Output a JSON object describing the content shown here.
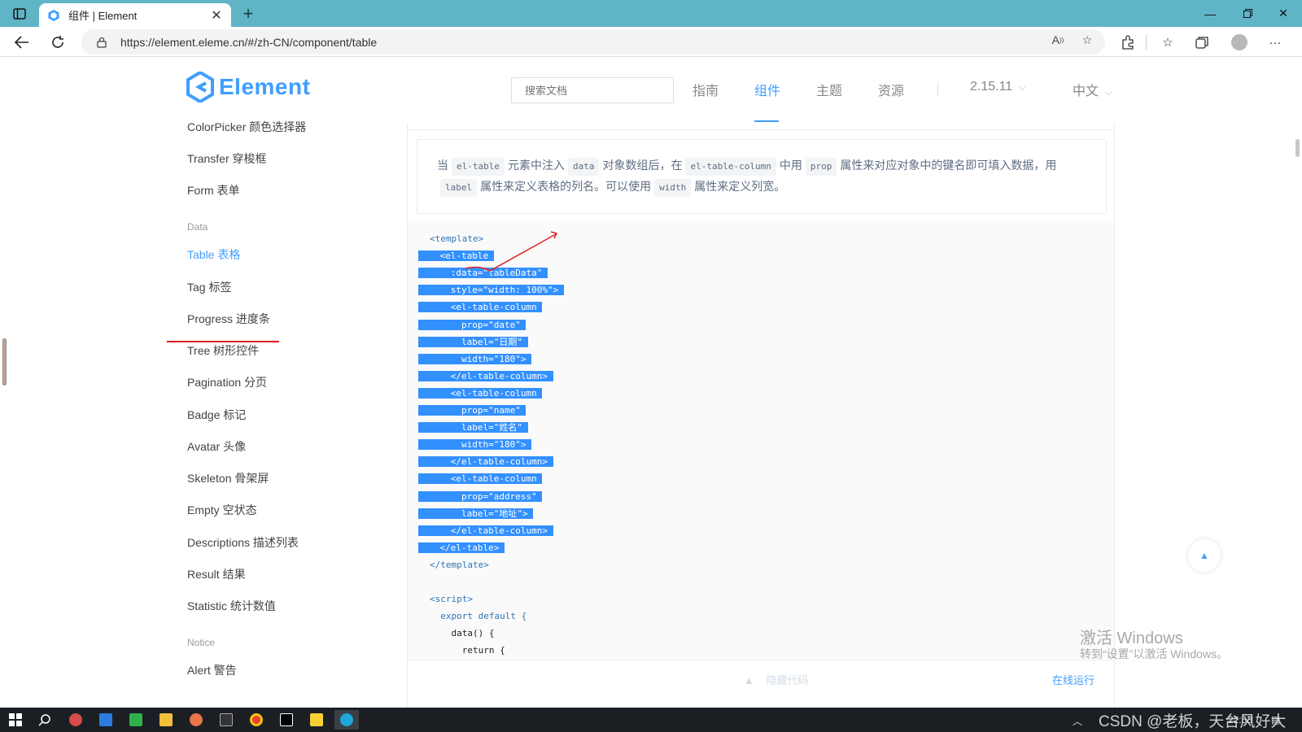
{
  "browser": {
    "tab_title": "组件 | Element",
    "url": "https://element.eleme.cn/#/zh-CN/component/table"
  },
  "header": {
    "logo_text": "Element",
    "search_placeholder": "搜索文档",
    "nav": [
      "指南",
      "组件",
      "主题",
      "资源"
    ],
    "active_nav": "组件",
    "version": "2.15.11",
    "language": "中文"
  },
  "sidebar": {
    "items_top": [
      "ColorPicker 颜色选择器",
      "Transfer 穿梭框",
      "Form 表单"
    ],
    "group_data": "Data",
    "items_data": [
      "Table 表格",
      "Tag 标签",
      "Progress 进度条",
      "Tree 树形控件",
      "Pagination 分页",
      "Badge 标记",
      "Avatar 头像",
      "Skeleton 骨架屏",
      "Empty 空状态",
      "Descriptions 描述列表",
      "Result 结果",
      "Statistic 统计数值"
    ],
    "group_notice": "Notice",
    "items_notice": [
      "Alert 警告"
    ],
    "active_item": "Table 表格"
  },
  "description": {
    "p1": "当",
    "t1": "el-table",
    "p2": "元素中注入",
    "t2": "data",
    "p3": "对象数组后，在",
    "t3": "el-table-column",
    "p4": "中用",
    "t4": "prop",
    "p5": "属性来对应对象中的键名即可填入数据，用",
    "t5": "label",
    "p6": "属性来定义表格的列名。可以使用",
    "t6": "width",
    "p7": "属性来定义列宽。"
  },
  "code": {
    "lines": [
      "<template>",
      "  <el-table",
      "    :data=\"tableData\"",
      "    style=\"width: 100%\">",
      "    <el-table-column",
      "      prop=\"date\"",
      "      label=\"日期\"",
      "      width=\"180\">",
      "    </el-table-column>",
      "    <el-table-column",
      "      prop=\"name\"",
      "      label=\"姓名\"",
      "      width=\"180\">",
      "    </el-table-column>",
      "    <el-table-column",
      "      prop=\"address\"",
      "      label=\"地址\">",
      "    </el-table-column>",
      "  </el-table>",
      "</template>",
      "",
      "<script>",
      "  export default {",
      "    data() {",
      "      return {"
    ],
    "hide_label": "隐藏代码",
    "run_label": "在线运行"
  },
  "overlay": {
    "watermark_title": "激活 Windows",
    "watermark_sub": "转到“设置”以激活 Windows。",
    "csdn": "CSDN @老板，天台风好大"
  },
  "taskbar": {
    "time": "22:53"
  },
  "colors": {
    "accent": "#409eff",
    "selection": "#3390ff",
    "annotation": "#e02020",
    "tabbar": "#5fb4c6"
  }
}
